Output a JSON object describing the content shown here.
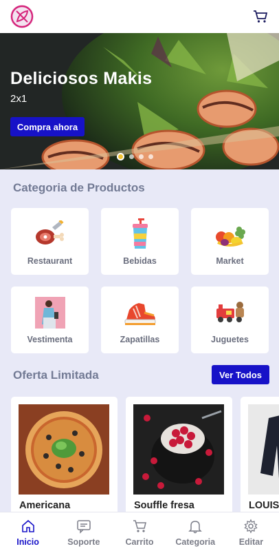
{
  "header": {
    "logo_icon": "leaf-utensils-logo-icon",
    "cart_icon": "cart-icon"
  },
  "hero": {
    "title": "Deliciosos Makis",
    "subtitle": "2x1",
    "button_label": "Compra ahora",
    "slides_count": 4,
    "active_slide": 1
  },
  "categories": {
    "title": "Categoria de Productos",
    "items": [
      {
        "label": "Restaurant",
        "icon": "ham-icon"
      },
      {
        "label": "Bebidas",
        "icon": "drink-cup-icon"
      },
      {
        "label": "Market",
        "icon": "fruits-icon"
      },
      {
        "label": "Vestimenta",
        "icon": "clothing-model-icon"
      },
      {
        "label": "Zapatillas",
        "icon": "sneaker-icon"
      },
      {
        "label": "Juguetes",
        "icon": "toy-train-icon"
      }
    ]
  },
  "offers": {
    "title": "Oferta Limitada",
    "see_all_label": "Ver Todos",
    "items": [
      {
        "name": "Americana",
        "image": "pizza-image"
      },
      {
        "name": "Souffle fresa",
        "image": "raspberry-dessert-image"
      },
      {
        "name": "LOUIS",
        "image": "jacket-image"
      }
    ]
  },
  "nav": {
    "items": [
      {
        "label": "Inicio",
        "icon": "home-icon",
        "active": true
      },
      {
        "label": "Soporte",
        "icon": "support-icon",
        "active": false
      },
      {
        "label": "Carrito",
        "icon": "cart-icon",
        "active": false
      },
      {
        "label": "Categoria",
        "icon": "bell-icon",
        "active": false
      },
      {
        "label": "Editar",
        "icon": "gear-icon",
        "active": false
      }
    ]
  },
  "colors": {
    "accent": "#1712c8",
    "background": "#e8e9f7",
    "logo_pink": "#d6237a"
  }
}
